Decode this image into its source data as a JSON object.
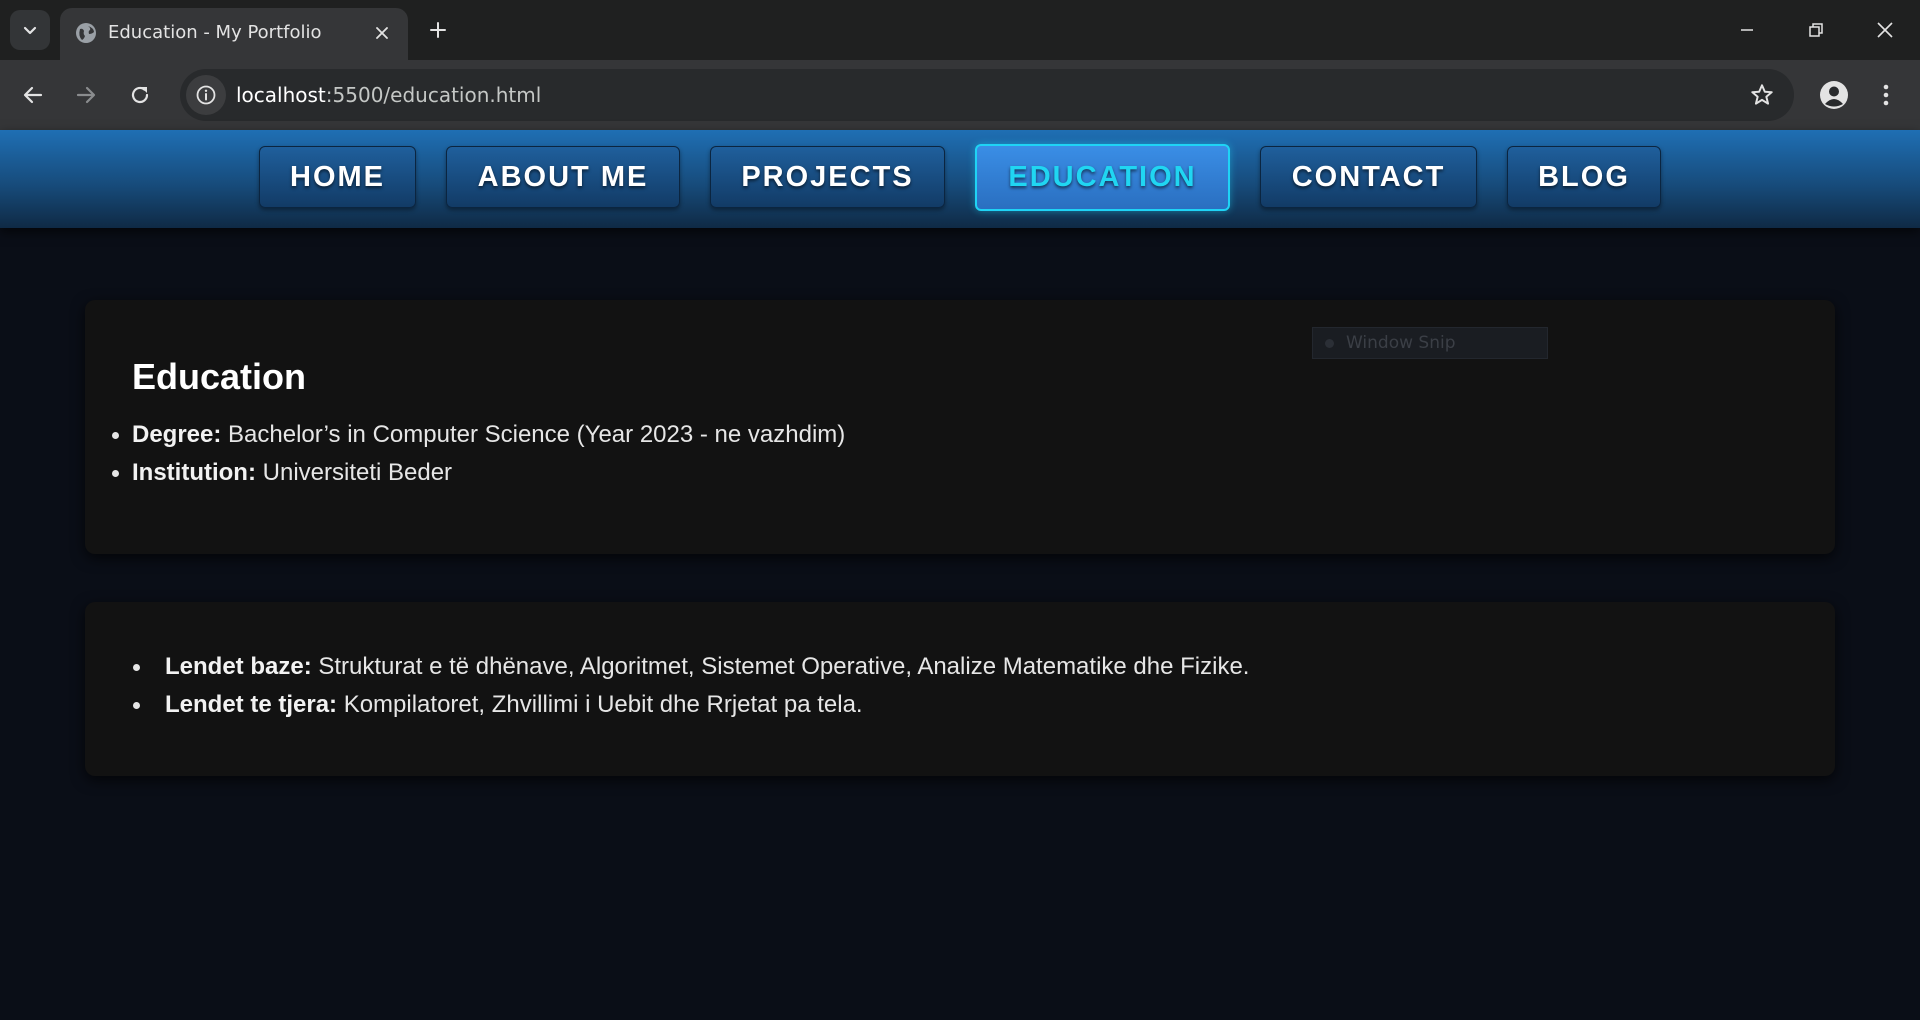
{
  "browser": {
    "tab_title": "Education - My Portfolio",
    "url_host": "localhost",
    "url_rest": ":5500/education.html"
  },
  "nav": {
    "items": [
      {
        "label": "HOME"
      },
      {
        "label": "ABOUT ME"
      },
      {
        "label": "PROJECTS"
      },
      {
        "label": "EDUCATION"
      },
      {
        "label": "CONTACT"
      },
      {
        "label": "BLOG"
      }
    ],
    "active": "EDUCATION",
    "active_color": "#20d6f2",
    "active_border": "#1fd3f5"
  },
  "education": {
    "title": "Education",
    "items": [
      {
        "label": "Degree:",
        "value": " Bachelor’s in Computer Science (Year 2023 - ne vazhdim)"
      },
      {
        "label": "Institution:",
        "value": " Universiteti Beder"
      }
    ]
  },
  "courses": {
    "items": [
      {
        "label": "Lendet baze:",
        "value": " Strukturat e të dhënave, Algoritmet, Sistemet Operative, Analize Matematike dhe Fizike."
      },
      {
        "label": "Lendet te tjera:",
        "value": " Kompilatoret, Zhvillimi i Uebit dhe Rrjetat pa tela."
      }
    ]
  },
  "overlay": {
    "label": "Window Snip"
  }
}
